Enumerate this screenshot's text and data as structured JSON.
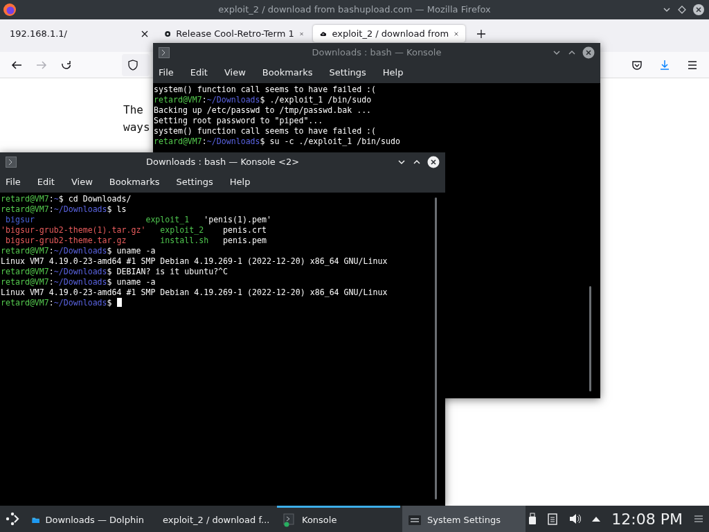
{
  "firefox": {
    "title": "exploit_2 / download from bashupload.com — Mozilla Firefox",
    "tabs": [
      {
        "label": "192.168.1.1/",
        "selected": false
      },
      {
        "label": "Release Cool-Retro-Term 1",
        "selected": false
      },
      {
        "label": "exploit_2 / download from",
        "selected": true
      }
    ],
    "forward_disabled": true,
    "page_text": [
      "The",
      "ways"
    ]
  },
  "konsole_back": {
    "title": "Downloads : bash — Konsole",
    "active": false,
    "menu": [
      "File",
      "Edit",
      "View",
      "Bookmarks",
      "Settings",
      "Help"
    ],
    "lines": [
      [
        {
          "t": "system() function call seems to have failed :(",
          "kind": "plain"
        }
      ],
      [
        {
          "t": "retard@VM7",
          "kind": "user"
        },
        {
          "t": ":",
          "kind": "plain"
        },
        {
          "t": "~/Downloads",
          "kind": "path"
        },
        {
          "t": "$ ./exploit_1 /bin/sudo",
          "kind": "plain"
        }
      ],
      [
        {
          "t": "Backing up /etc/passwd to /tmp/passwd.bak ...",
          "kind": "plain"
        }
      ],
      [
        {
          "t": "Setting root password to \"piped\"...",
          "kind": "plain"
        }
      ],
      [
        {
          "t": "system() function call seems to have failed :(",
          "kind": "plain"
        }
      ],
      [
        {
          "t": "retard@VM7",
          "kind": "user"
        },
        {
          "t": ":",
          "kind": "plain"
        },
        {
          "t": "~/Downloads",
          "kind": "path"
        },
        {
          "t": "$ su -c ./exploit_1 /bin/sudo",
          "kind": "plain"
        }
      ]
    ]
  },
  "konsole_front": {
    "title": "Downloads : bash — Konsole <2>",
    "active": true,
    "menu": [
      "File",
      "Edit",
      "View",
      "Bookmarks",
      "Settings",
      "Help"
    ],
    "lines": [
      [
        {
          "t": "retard@VM7",
          "kind": "user"
        },
        {
          "t": ":",
          "kind": "plain"
        },
        {
          "t": "~",
          "kind": "path"
        },
        {
          "t": "$ cd Downloads/",
          "kind": "plain"
        }
      ],
      [
        {
          "t": "retard@VM7",
          "kind": "user"
        },
        {
          "t": ":",
          "kind": "plain"
        },
        {
          "t": "~/Downloads",
          "kind": "path"
        },
        {
          "t": "$ ls",
          "kind": "plain"
        }
      ],
      [
        {
          "t": " bigsur                       ",
          "kind": "dir"
        },
        {
          "t": "exploit_1   ",
          "kind": "exec"
        },
        {
          "t": "'penis(1).pem'",
          "kind": "plain"
        }
      ],
      [
        {
          "t": "'bigsur-grub2-theme(1).tar.gz'   ",
          "kind": "archive"
        },
        {
          "t": "exploit_2    ",
          "kind": "exec"
        },
        {
          "t": "penis.crt",
          "kind": "plain"
        }
      ],
      [
        {
          "t": " bigsur-grub2-theme.tar.gz       ",
          "kind": "archive"
        },
        {
          "t": "install.sh   ",
          "kind": "exec"
        },
        {
          "t": "penis.pem",
          "kind": "plain"
        }
      ],
      [
        {
          "t": "retard@VM7",
          "kind": "user"
        },
        {
          "t": ":",
          "kind": "plain"
        },
        {
          "t": "~/Downloads",
          "kind": "path"
        },
        {
          "t": "$ uname -a",
          "kind": "plain"
        }
      ],
      [
        {
          "t": "Linux VM7 4.19.0-23-amd64 #1 SMP Debian 4.19.269-1 (2022-12-20) x86_64 GNU/Linux",
          "kind": "plain"
        }
      ],
      [
        {
          "t": "retard@VM7",
          "kind": "user"
        },
        {
          "t": ":",
          "kind": "plain"
        },
        {
          "t": "~/Downloads",
          "kind": "path"
        },
        {
          "t": "$ DEBIAN? is it ubuntu?^C",
          "kind": "plain"
        }
      ],
      [
        {
          "t": "retard@VM7",
          "kind": "user"
        },
        {
          "t": ":",
          "kind": "plain"
        },
        {
          "t": "~/Downloads",
          "kind": "path"
        },
        {
          "t": "$ uname -a",
          "kind": "plain"
        }
      ],
      [
        {
          "t": "Linux VM7 4.19.0-23-amd64 #1 SMP Debian 4.19.269-1 (2022-12-20) x86_64 GNU/Linux",
          "kind": "plain"
        }
      ],
      [
        {
          "t": "retard@VM7",
          "kind": "user"
        },
        {
          "t": ":",
          "kind": "plain"
        },
        {
          "t": "~/Downloads",
          "kind": "path"
        },
        {
          "t": "$ ",
          "kind": "plain"
        },
        {
          "kind": "cursor"
        }
      ]
    ]
  },
  "taskbar": {
    "tasks": [
      {
        "label": "Downloads — Dolphin",
        "selected": false,
        "hovered": false
      },
      {
        "label": "exploit_2 / download f...",
        "selected": false,
        "hovered": false
      },
      {
        "label": "Konsole",
        "selected": true,
        "hovered": false
      },
      {
        "label": "System Settings",
        "selected": false,
        "hovered": true
      }
    ],
    "clock": "12:08 PM"
  }
}
